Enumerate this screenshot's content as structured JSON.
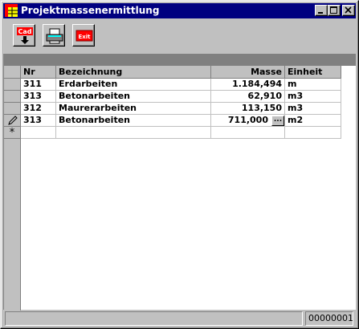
{
  "window": {
    "title": "Projektmassenermittlung"
  },
  "toolbar": {
    "cad_label": "Cad",
    "exit_label": "Exit"
  },
  "grid": {
    "columns": [
      "Nr",
      "Bezeichnung",
      "Masse",
      "Einheit"
    ],
    "rows": [
      {
        "nr": "311",
        "bezeichnung": "Erdarbeiten",
        "masse": "1.184,494",
        "einheit": "m"
      },
      {
        "nr": "313",
        "bezeichnung": "Betonarbeiten",
        "masse": "62,910",
        "einheit": "m3"
      },
      {
        "nr": "312",
        "bezeichnung": "Maurerarbeiten",
        "masse": "113,150",
        "einheit": "m3"
      },
      {
        "nr": "313",
        "bezeichnung": "Betonarbeiten",
        "masse": "711,000",
        "einheit": "m2"
      }
    ],
    "new_row_marker": "*",
    "ellipsis_label": "..."
  },
  "statusbar": {
    "record": "00000001"
  },
  "colors": {
    "titlebar": "#000080",
    "face": "#c0c0c0"
  }
}
